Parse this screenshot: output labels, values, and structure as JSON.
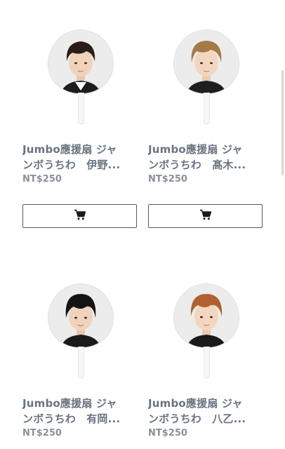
{
  "products": [
    {
      "title_line1": "Jumbo應援扇 ジャ",
      "title_line2": "ンボうちわ　伊野...",
      "price": "NT$250",
      "hair_color": "#2a1c16",
      "cart_icon": "cart-icon"
    },
    {
      "title_line1": "Jumbo應援扇 ジャ",
      "title_line2": "ンボうちわ　髙木...",
      "price": "NT$250",
      "hair_color": "#a6794a",
      "cart_icon": "cart-icon"
    },
    {
      "title_line1": "Jumbo應援扇 ジャ",
      "title_line2": "ンボうちわ　有岡...",
      "price": "NT$250",
      "hair_color": "#141414",
      "cart_icon": "cart-icon"
    },
    {
      "title_line1": "Jumbo應援扇 ジャ",
      "title_line2": "ンボうちわ　八乙...",
      "price": "NT$250",
      "hair_color": "#b0612f",
      "cart_icon": "cart-icon"
    }
  ]
}
